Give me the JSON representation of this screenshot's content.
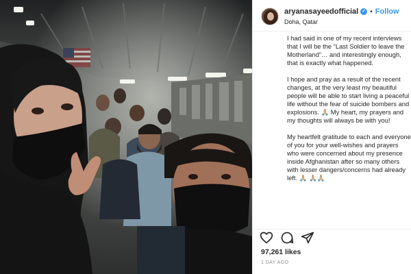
{
  "post": {
    "username": "aryanasayeedofficial",
    "verified_mark": "✓",
    "separator": "•",
    "follow_label": "Follow",
    "location": "Doha, Qatar",
    "caption_paragraphs": [
      "I had said in one of my recent interviews that I will be the “Last Soldier to leave the Motherland”… and interestingly enough, that is exactly what happened.",
      "I hope and pray as a result of the recent changes, at the very least my beautiful people will be able to start living a peaceful life without the fear of suicide bombers and explosions. 🙏🏼 My heart, my prayers and my thoughts will always be with you!",
      "My heartfelt gratitude to each and everyone of you for your well-wishes and prayers who were concerned about my presence inside Afghanistan after so many others with lesser dangers/concerns had already left. 🙏🏼 🙏🏼🙏🏼"
    ],
    "likes": "97,261 likes",
    "time_ago": "1 DAY AGO"
  },
  "icons": {
    "like": "heart-icon",
    "comment": "comment-icon",
    "share": "share-icon"
  },
  "colors": {
    "accent": "#3897f0",
    "text": "#262626",
    "muted": "#8e8e8e",
    "border": "#efefef"
  }
}
